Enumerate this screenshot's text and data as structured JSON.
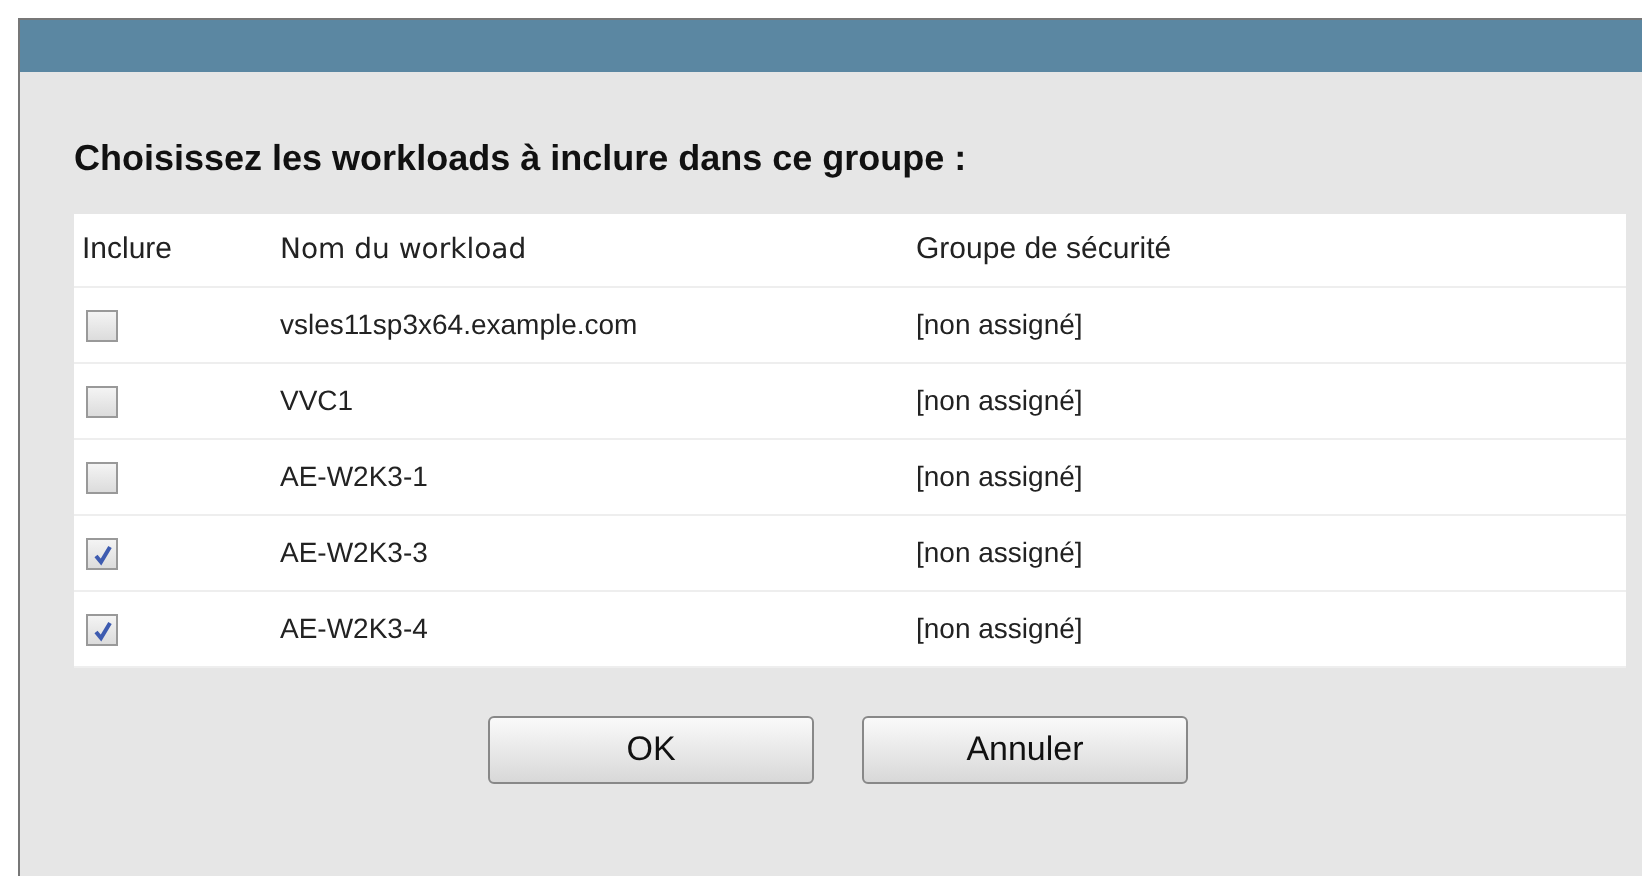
{
  "dialog": {
    "heading": "Choisissez les workloads à inclure dans ce groupe :"
  },
  "table": {
    "columns": [
      "Inclure",
      "Nom du workload",
      "Groupe de sécurité"
    ],
    "rows": [
      {
        "checked": false,
        "name": "vsles11sp3x64.example.com",
        "group": "[non assigné]"
      },
      {
        "checked": false,
        "name": "VVC1",
        "group": "[non assigné]"
      },
      {
        "checked": false,
        "name": "AE-W2K3-1",
        "group": "[non assigné]"
      },
      {
        "checked": true,
        "name": "AE-W2K3-3",
        "group": "[non assigné]"
      },
      {
        "checked": true,
        "name": "AE-W2K3-4",
        "group": "[non assigné]"
      }
    ]
  },
  "buttons": [
    "OK",
    "Annuler"
  ]
}
